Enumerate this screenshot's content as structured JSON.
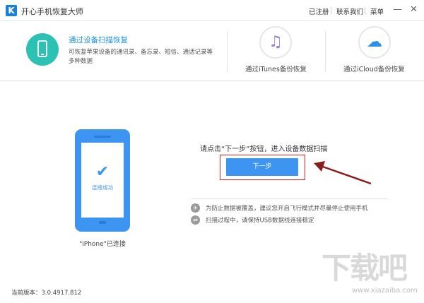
{
  "titlebar": {
    "logo_letter": "K",
    "app_title": "开心手机恢复大师",
    "registered": "已注册",
    "contact": "联系我们",
    "menu": "菜单",
    "minimize": "—",
    "close": "✕"
  },
  "modes": {
    "device_scan": {
      "title": "通过设备扫描恢复",
      "description": "可恢复苹果设备的通讯录、备忘录、短信、通话记录等多种数据"
    },
    "itunes": {
      "label": "通过iTunes备份恢复",
      "icon": "music-note-icon",
      "glyph": "♫"
    },
    "icloud": {
      "label": "通过iCloud备份恢复",
      "icon": "cloud-icon",
      "glyph": "☁"
    }
  },
  "device": {
    "check_glyph": "✔",
    "screen_text": "连接成功",
    "caption": "\"iPhone\"已连接"
  },
  "main": {
    "prompt": "请点击“下一步”按钮，进入设备数据扫描",
    "next_button": "下一步"
  },
  "tips": [
    {
      "icon": "airplane-icon",
      "glyph": "✈",
      "text": "为防止数据被覆盖，建议您开启飞行模式并尽量停止使用手机"
    },
    {
      "icon": "usb-icon",
      "glyph": "⇌",
      "text": "扫描过程中，请保持USB数据线连接稳定"
    }
  ],
  "footer": {
    "version": "当前版本：3.0.4917.812"
  },
  "watermark": {
    "main": "下载吧",
    "sub": "www.xiazaiba.com"
  },
  "colors": {
    "accent_blue": "#3e95f1",
    "teal": "#2bc2b3",
    "highlight_red": "#e02424",
    "itunes_purple": "#9b7ed8"
  }
}
